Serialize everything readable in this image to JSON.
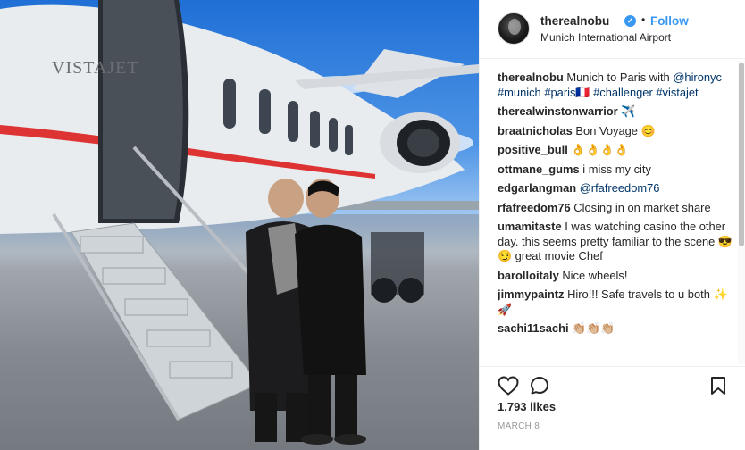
{
  "post": {
    "username": "therealnobu",
    "verified_badge": "verified-icon",
    "separator": "•",
    "follow_label": "Follow",
    "location": "Munich International Airport",
    "photo": {
      "plane_logo": "VISTAJET"
    }
  },
  "caption": {
    "username": "therealnobu",
    "text": "Munich to Paris with",
    "links": [
      "@hironyc",
      "#munich",
      "#paris🇫🇷",
      "#challenger",
      "#vistajet"
    ]
  },
  "comments": [
    {
      "username": "therealwinstonwarrior",
      "text": "✈️"
    },
    {
      "username": "braatnicholas",
      "text": "Bon Voyage 😊"
    },
    {
      "username": "positive_bull",
      "text": "👌👌👌👌"
    },
    {
      "username": "ottmane_gums",
      "text": "i miss my city"
    },
    {
      "username": "edgarlangman",
      "text": "@rfafreedom76"
    },
    {
      "username": "rfafreedom76",
      "text": "Closing in on market share"
    },
    {
      "username": "umamitaste",
      "text": "I was watching casino the other day. this seems pretty familiar to the scene 😎😏 great movie Chef"
    },
    {
      "username": "barolloitaly",
      "text": "Nice wheels!"
    },
    {
      "username": "jimmypaintz",
      "text": "Hiro!!! Safe travels to u both ✨🚀"
    },
    {
      "username": "sachi11sachi",
      "text": "👏🏼👏🏼👏🏼"
    }
  ],
  "actions": {
    "like_icon": "heart-icon",
    "comment_icon": "comment-icon",
    "save_icon": "bookmark-icon",
    "likes": "1,793 likes",
    "date": "MARCH 8"
  }
}
